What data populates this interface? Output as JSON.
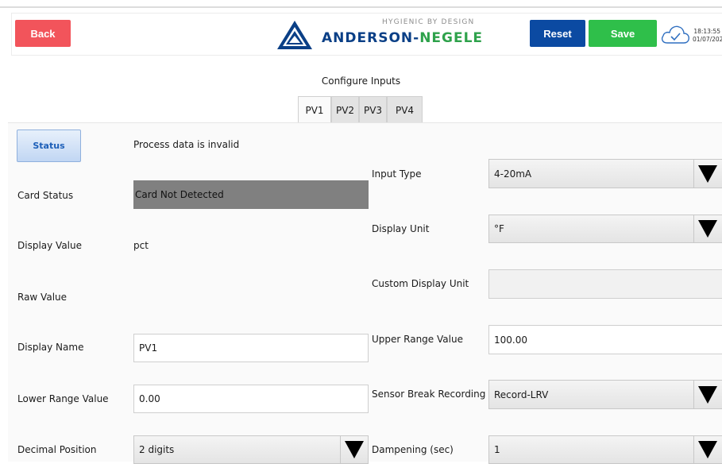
{
  "header": {
    "back_label": "Back",
    "reset_label": "Reset",
    "save_label": "Save",
    "logo_tagline": "HYGIENIC BY DESIGN",
    "logo_name_a": "ANDERSON-",
    "logo_name_b": "NEGELE",
    "time": "18:13:55",
    "date": "01/07/202",
    "icons": [
      "anderson-negele-logo",
      "cloud-check-icon"
    ]
  },
  "page": {
    "title": "Configure Inputs",
    "tabs": [
      {
        "label": "PV1",
        "active": true
      },
      {
        "label": "PV2",
        "active": false
      },
      {
        "label": "PV3",
        "active": false
      },
      {
        "label": "PV4",
        "active": false
      }
    ]
  },
  "left": {
    "status_button": "Status",
    "status_message": "Process data is invalid",
    "card_status_label": "Card Status",
    "card_status_value": "Card Not Detected",
    "display_value_label": "Display Value",
    "display_value": "pct",
    "raw_value_label": "Raw Value",
    "raw_value": "",
    "display_name_label": "Display Name",
    "display_name_value": "PV1",
    "lower_range_label": "Lower Range Value",
    "lower_range_value": "0.00",
    "decimal_position_label": "Decimal Position",
    "decimal_position_value": "2 digits"
  },
  "right": {
    "input_type_label": "Input Type",
    "input_type_value": "4-20mA",
    "display_unit_label": "Display Unit",
    "display_unit_value": "°F",
    "custom_unit_label": "Custom Display Unit",
    "custom_unit_value": "",
    "upper_range_label": "Upper Range Value",
    "upper_range_value": "100.00",
    "sensor_break_label": "Sensor Break Recording",
    "sensor_break_value": "Record-LRV",
    "dampening_label": "Dampening (sec)",
    "dampening_value": "1"
  },
  "colors": {
    "back": "#f2545b",
    "reset": "#0b4aa2",
    "save": "#2fbf4a",
    "card_status_bg": "#808080",
    "logo_blue": "#0a3f86",
    "logo_green": "#2ea24b"
  }
}
